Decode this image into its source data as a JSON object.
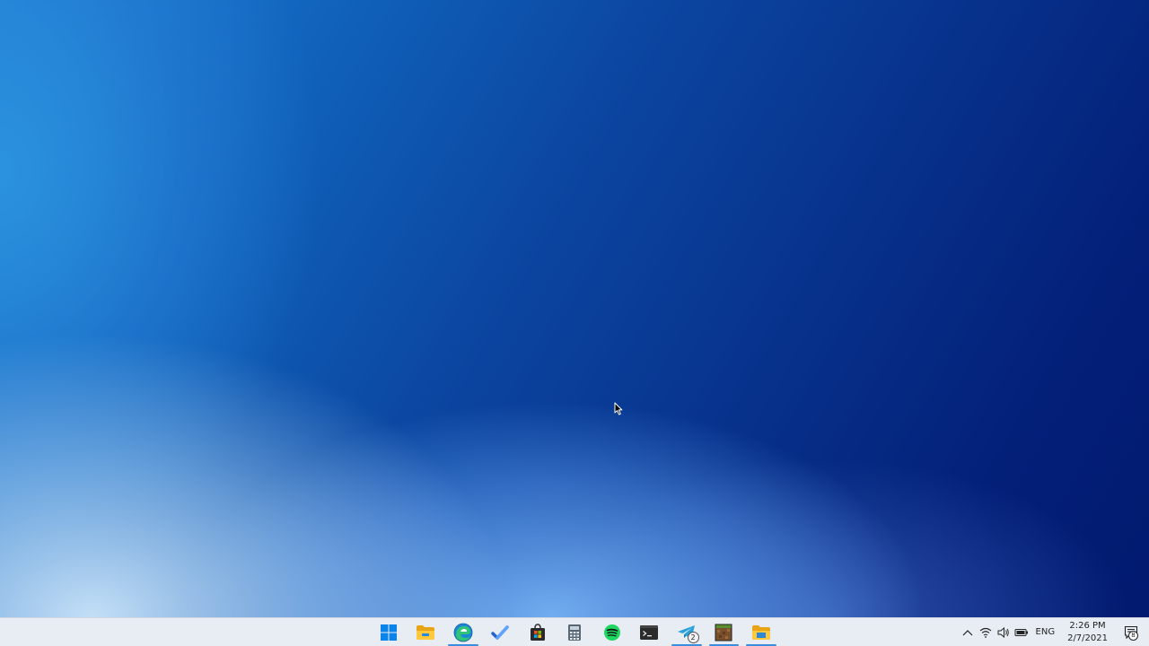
{
  "desktop": {
    "wallpaper": "blue-gradient",
    "colors": {
      "top_left": "#1f7fd4",
      "bottom_left": "#cde6fa",
      "right": "#021a70"
    }
  },
  "taskbar": {
    "background": "#e7edf3",
    "apps": [
      {
        "name": "Start",
        "icon": "windows-logo-icon",
        "running": false
      },
      {
        "name": "File Explorer",
        "icon": "folder-icon",
        "running": false
      },
      {
        "name": "Microsoft Edge",
        "icon": "edge-icon",
        "running": true
      },
      {
        "name": "Microsoft To Do",
        "icon": "checkmark-icon",
        "running": false
      },
      {
        "name": "Microsoft Store",
        "icon": "store-bag-icon",
        "running": false
      },
      {
        "name": "Calculator",
        "icon": "calculator-icon",
        "running": false
      },
      {
        "name": "Spotify",
        "icon": "spotify-icon",
        "running": false
      },
      {
        "name": "Terminal",
        "icon": "terminal-icon",
        "running": false
      },
      {
        "name": "Telegram",
        "icon": "telegram-icon",
        "running": true,
        "badge": "2"
      },
      {
        "name": "Minecraft",
        "icon": "minecraft-block-icon",
        "running": true
      },
      {
        "name": "File Explorer (open)",
        "icon": "folder-open-icon",
        "running": true
      }
    ],
    "tray": {
      "chevron": "chevron-up-icon",
      "network": "wifi-icon",
      "volume": "speaker-icon",
      "battery": "battery-icon",
      "language": "ENG",
      "time": "2:26 PM",
      "date": "2/7/2021",
      "notification_count": "8"
    }
  }
}
